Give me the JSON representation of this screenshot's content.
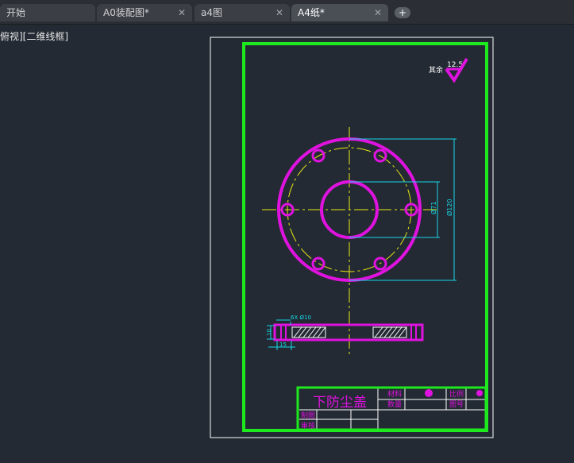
{
  "tabs": [
    {
      "label": "开始",
      "closable": false,
      "active": false
    },
    {
      "label": "A0装配图*",
      "closable": true,
      "active": false
    },
    {
      "label": "a4图",
      "closable": true,
      "active": false
    },
    {
      "label": "A4纸*",
      "closable": true,
      "active": true
    }
  ],
  "add_tab_label": "+",
  "close_glyph": "✕",
  "viewport_label": "俯视][二维线框]",
  "drawing": {
    "roughness_text": "其余",
    "roughness_value": "12.5",
    "dim_inner_dia": "Ø71",
    "dim_outer_dia": "Ø120",
    "dim_holes": "6X Ø10",
    "dim_thickness": "10",
    "dim_width": "15",
    "title_block": {
      "part_name": "下防尘盖",
      "cell_material": "材料",
      "cell_quantity": "数量",
      "cell_scale": "比例",
      "cell_drawing_no": "图号",
      "cell_drawer": "制图",
      "cell_reviewer": "审核"
    }
  },
  "colors": {
    "background": "#232a33",
    "frame_green": "#1ee81e",
    "geometry_magenta": "#e012e0",
    "center_yellow": "#e8e815",
    "dimension_cyan": "#17d7e8"
  }
}
